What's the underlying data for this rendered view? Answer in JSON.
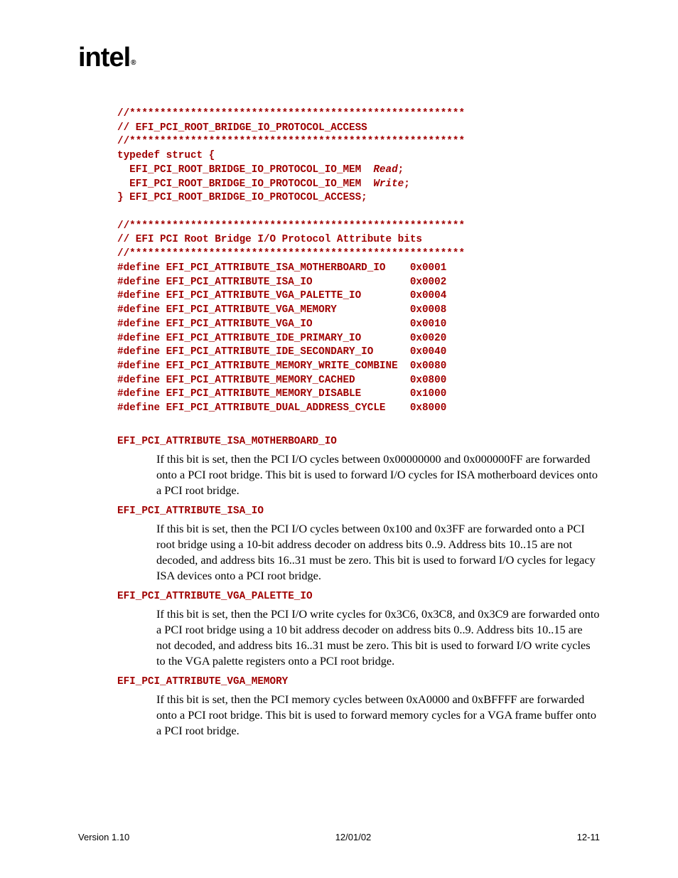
{
  "logo_text": "intel",
  "code_block": "//*******************************************************\n// EFI_PCI_ROOT_BRIDGE_IO_PROTOCOL_ACCESS\n//*******************************************************\ntypedef struct {\n  EFI_PCI_ROOT_BRIDGE_IO_PROTOCOL_IO_MEM  <i>Read</i>;\n  EFI_PCI_ROOT_BRIDGE_IO_PROTOCOL_IO_MEM  <i>Write</i>;\n} EFI_PCI_ROOT_BRIDGE_IO_PROTOCOL_ACCESS;\n\n//*******************************************************\n// EFI PCI Root Bridge I/O Protocol Attribute bits\n//*******************************************************\n#define EFI_PCI_ATTRIBUTE_ISA_MOTHERBOARD_IO    0x0001\n#define EFI_PCI_ATTRIBUTE_ISA_IO                0x0002\n#define EFI_PCI_ATTRIBUTE_VGA_PALETTE_IO        0x0004\n#define EFI_PCI_ATTRIBUTE_VGA_MEMORY            0x0008\n#define EFI_PCI_ATTRIBUTE_VGA_IO                0x0010\n#define EFI_PCI_ATTRIBUTE_IDE_PRIMARY_IO        0x0020\n#define EFI_PCI_ATTRIBUTE_IDE_SECONDARY_IO      0x0040\n#define EFI_PCI_ATTRIBUTE_MEMORY_WRITE_COMBINE  0x0080\n#define EFI_PCI_ATTRIBUTE_MEMORY_CACHED         0x0800\n#define EFI_PCI_ATTRIBUTE_MEMORY_DISABLE        0x1000\n#define EFI_PCI_ATTRIBUTE_DUAL_ADDRESS_CYCLE    0x8000",
  "attrs": [
    {
      "name": "EFI_PCI_ATTRIBUTE_ISA_MOTHERBOARD_IO",
      "text": "If this bit is set, then the PCI I/O cycles between 0x00000000 and 0x000000FF are forwarded onto a PCI root bridge.  This bit is used to forward I/O cycles for ISA motherboard devices onto a PCI root bridge."
    },
    {
      "name": "EFI_PCI_ATTRIBUTE_ISA_IO",
      "text": "If this bit is set, then the PCI I/O cycles between 0x100 and 0x3FF are forwarded onto a PCI root bridge using a 10-bit address decoder on address bits 0..9.  Address bits 10..15 are not decoded, and address bits 16..31 must be zero.  This bit is used to forward I/O cycles for legacy ISA devices onto a PCI root bridge."
    },
    {
      "name": "EFI_PCI_ATTRIBUTE_VGA_PALETTE_IO",
      "text": "If this bit is set, then the PCI I/O write cycles for 0x3C6, 0x3C8, and 0x3C9 are forwarded onto a PCI root bridge using a 10 bit address decoder on address bits 0..9.  Address bits 10..15 are not decoded, and address bits 16..31 must be zero.  This bit is used to forward I/O write cycles to the VGA palette registers onto a PCI root bridge."
    },
    {
      "name": "EFI_PCI_ATTRIBUTE_VGA_MEMORY",
      "text": "If this bit is set, then the PCI memory cycles between 0xA0000 and 0xBFFFF are forwarded onto a PCI root bridge.  This bit is used to forward memory cycles for a VGA frame buffer onto a PCI root bridge."
    }
  ],
  "footer": {
    "left": "Version 1.10",
    "center": "12/01/02",
    "right": "12-11"
  }
}
